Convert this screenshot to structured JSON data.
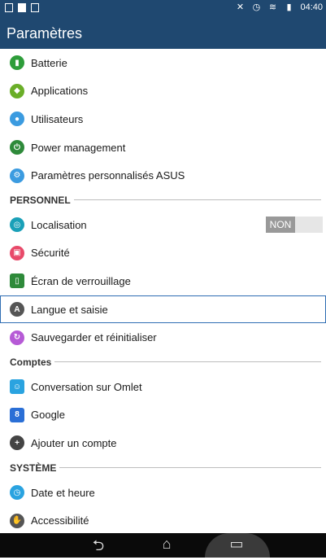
{
  "status_bar": {
    "time": "04:40"
  },
  "app_bar": {
    "title": "Paramètres"
  },
  "items_top": [
    {
      "label": "Batterie",
      "icon": "battery-icon",
      "color": "#2e9d3a"
    },
    {
      "label": "Applications",
      "icon": "apps-icon",
      "color": "#6aae28"
    },
    {
      "label": "Utilisateurs",
      "icon": "user-icon",
      "color": "#3b9be0"
    },
    {
      "label": "Power management",
      "icon": "power-management-icon",
      "color": "#2e8a3a"
    },
    {
      "label": "Paramètres personnalisés ASUS",
      "icon": "asus-settings-icon",
      "color": "#3b9be0"
    }
  ],
  "section_personnel": {
    "title": "PERSONNEL"
  },
  "items_personnel": [
    {
      "label": "Localisation",
      "icon": "location-icon",
      "color": "#1aa0b8"
    },
    {
      "label": "Sécurité",
      "icon": "lock-icon",
      "color": "#e84a6a"
    },
    {
      "label": "Écran de verrouillage",
      "icon": "lock-screen-icon",
      "color": "#2e8a3a"
    },
    {
      "label": "Langue et saisie",
      "icon": "language-icon",
      "color": "#555555"
    },
    {
      "label": "Sauvegarder et réinitialiser",
      "icon": "backup-icon",
      "color": "#b65ad6"
    }
  ],
  "location_toggle": {
    "label": "NON"
  },
  "section_comptes": {
    "title": "Comptes"
  },
  "items_comptes": [
    {
      "label": "Conversation sur Omlet",
      "icon": "omlet-icon",
      "color": "#2aa3e0"
    },
    {
      "label": "Google",
      "icon": "google-icon",
      "color": "#2a6fd6"
    },
    {
      "label": "Ajouter un compte",
      "icon": "add-account-icon",
      "color": "#444444"
    }
  ],
  "section_systeme": {
    "title": "SYSTÈME"
  },
  "items_systeme": [
    {
      "label": "Date et heure",
      "icon": "clock-icon",
      "color": "#2aa3e0"
    },
    {
      "label": "Accessibilité",
      "icon": "accessibility-icon",
      "color": "#555555"
    }
  ],
  "navigation": {
    "back_icon": "back-icon",
    "home_icon": "home-icon",
    "recent_icon": "recent-apps-icon"
  },
  "colors": {
    "header": "#1f4870",
    "selection": "#2f6db3"
  }
}
